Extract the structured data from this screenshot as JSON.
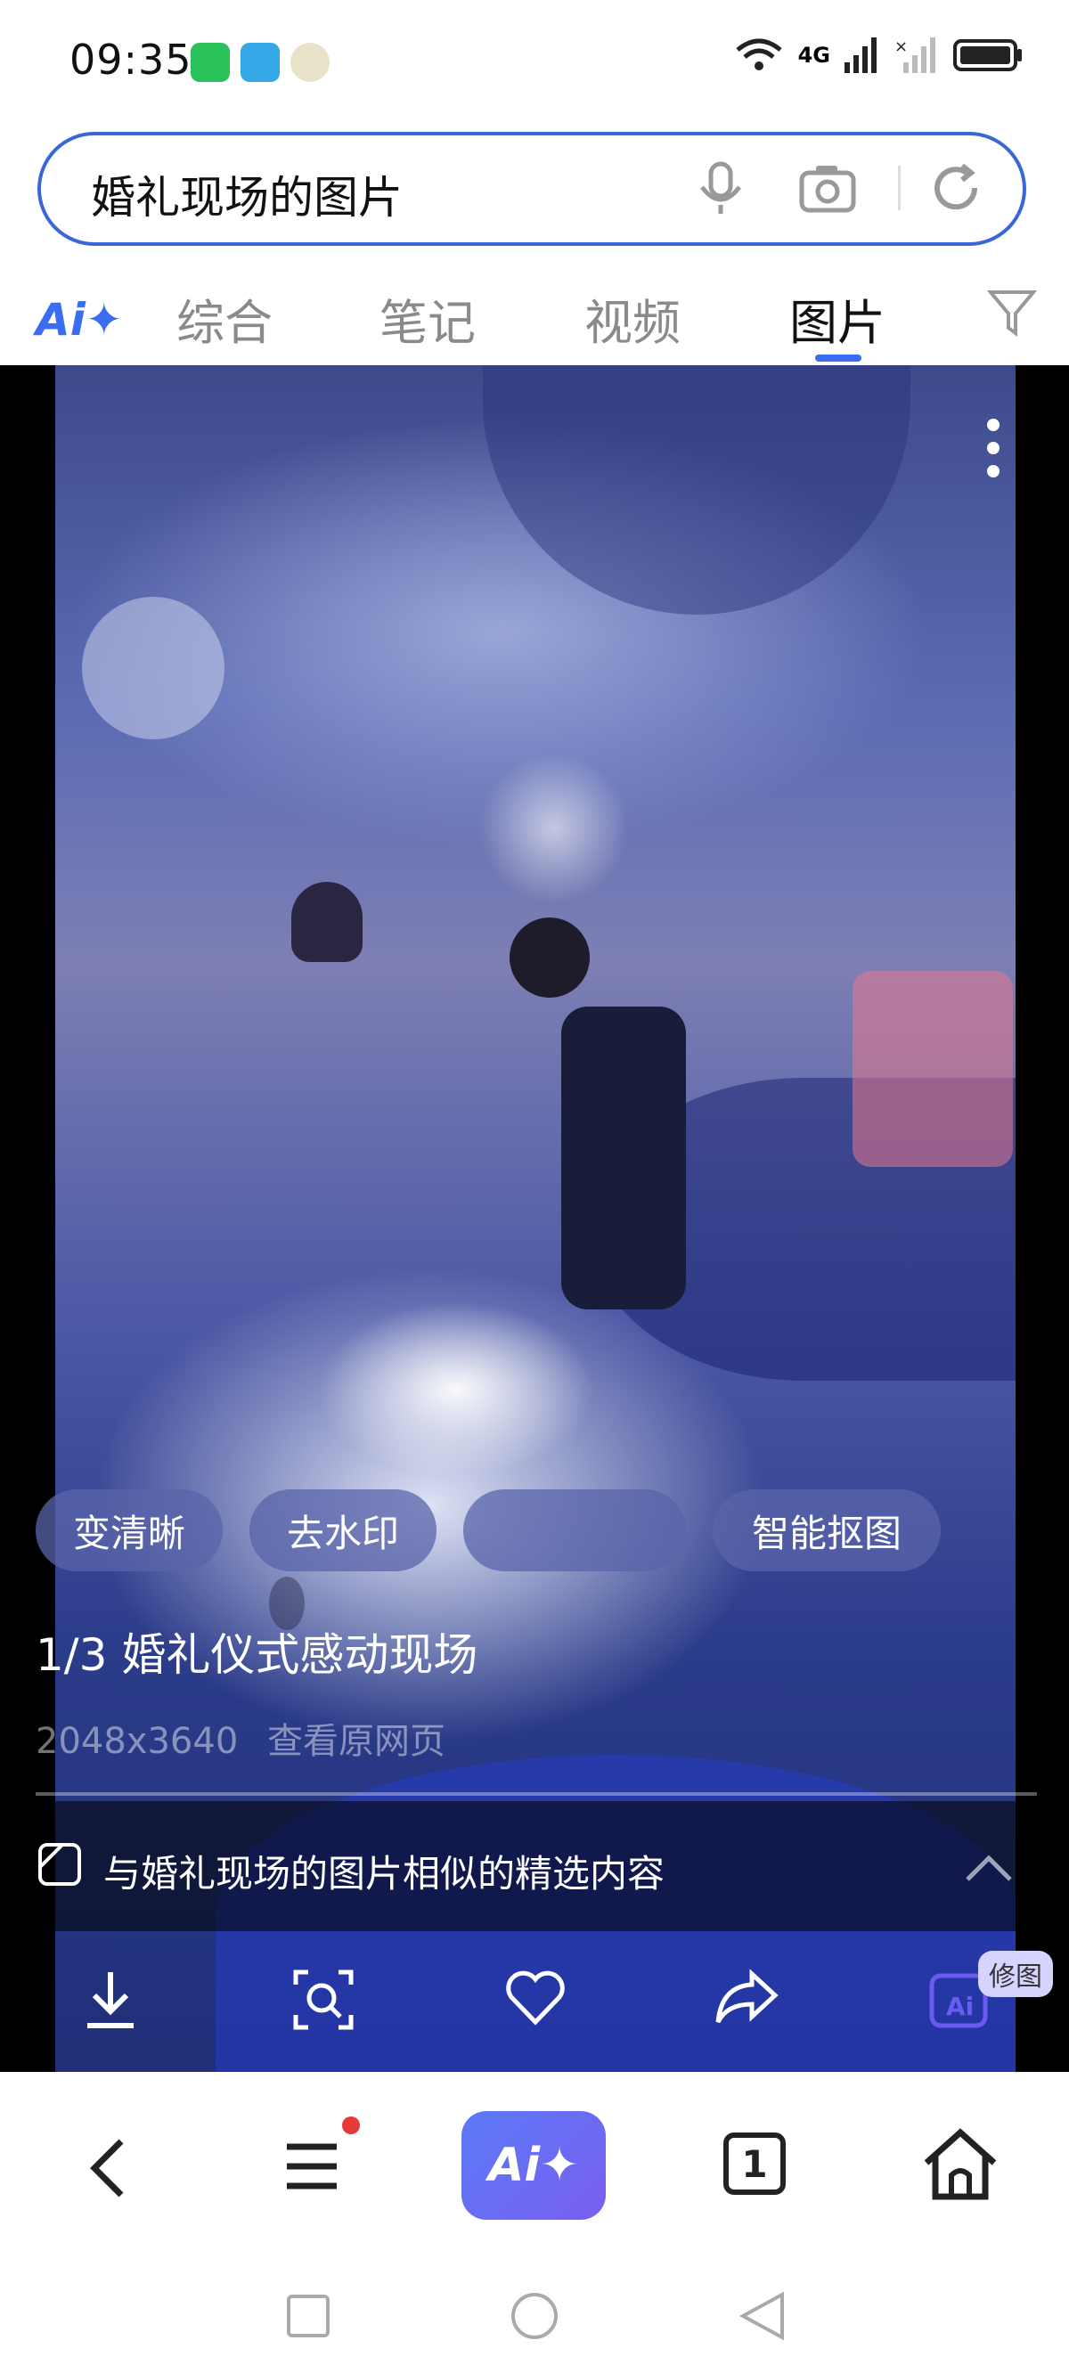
{
  "status_bar": {
    "time": "09:35",
    "network": "4G"
  },
  "search": {
    "query": "婚礼现场的图片"
  },
  "tabs": [
    {
      "label": "综合"
    },
    {
      "label": "笔记"
    },
    {
      "label": "视频"
    },
    {
      "label": "图片",
      "active": true
    }
  ],
  "tabs_ai_label": "Ai✦",
  "image_tools": [
    "变清晰",
    "去水印",
    "",
    "智能抠图"
  ],
  "viewer": {
    "caption": "1/3  婚礼仪式感动现场",
    "dimensions": "2048x3640",
    "source_link": "查看原网页",
    "similar_text": "与婚礼现场的图片相似的精选内容",
    "edit_badge": "修图"
  },
  "nav": {
    "ai_label": "Ai✦",
    "tab_count": "1"
  },
  "colors": {
    "accent": "#3a6df0",
    "search_border": "#3a67d8"
  }
}
